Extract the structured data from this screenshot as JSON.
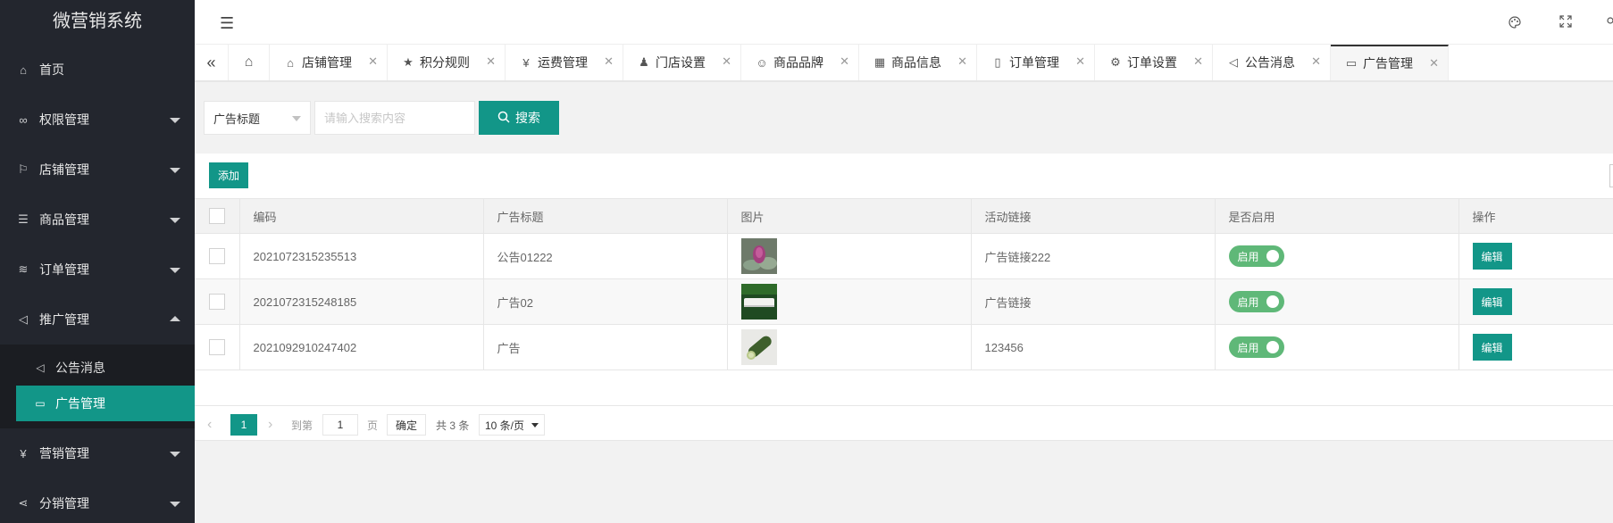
{
  "app": {
    "title": "微营销系统"
  },
  "sidebar": {
    "items": [
      {
        "label": "首页",
        "icon": "home-icon",
        "glyph": "⌂"
      },
      {
        "label": "权限管理",
        "icon": "link-icon",
        "glyph": "∞"
      },
      {
        "label": "店铺管理",
        "icon": "flag-icon",
        "glyph": "⚐"
      },
      {
        "label": "商品管理",
        "icon": "list-icon",
        "glyph": "☰"
      },
      {
        "label": "订单管理",
        "icon": "layers-icon",
        "glyph": "≋"
      },
      {
        "label": "推广管理",
        "icon": "speaker-icon",
        "glyph": "◁"
      },
      {
        "label": "营销管理",
        "icon": "yen-icon",
        "glyph": "¥"
      },
      {
        "label": "分销管理",
        "icon": "share-icon",
        "glyph": "⋖"
      }
    ],
    "submenu": [
      {
        "label": "公告消息",
        "icon": "speaker-icon",
        "glyph": "◁"
      },
      {
        "label": "广告管理",
        "icon": "book-icon",
        "glyph": "▭"
      }
    ]
  },
  "header": {
    "fold_glyph": "☰"
  },
  "tabs": [
    {
      "label": "店铺管理",
      "icon": "home-icon",
      "glyph": "⌂"
    },
    {
      "label": "积分规则",
      "icon": "star-icon",
      "glyph": "★"
    },
    {
      "label": "运费管理",
      "icon": "yen-icon",
      "glyph": "¥"
    },
    {
      "label": "门店设置",
      "icon": "users-icon",
      "glyph": "♟"
    },
    {
      "label": "商品品牌",
      "icon": "smile-icon",
      "glyph": "☺"
    },
    {
      "label": "商品信息",
      "icon": "calendar-icon",
      "glyph": "▦"
    },
    {
      "label": "订单管理",
      "icon": "clipboard-icon",
      "glyph": "▯"
    },
    {
      "label": "订单设置",
      "icon": "gear-icon",
      "glyph": "⚙"
    },
    {
      "label": "公告消息",
      "icon": "speaker-icon",
      "glyph": "◁"
    },
    {
      "label": "广告管理",
      "icon": "book-icon",
      "glyph": "▭"
    }
  ],
  "search": {
    "field_select": "广告标题",
    "placeholder": "请输入搜索内容",
    "button_label": "搜索"
  },
  "toolbar": {
    "add_label": "添加"
  },
  "table": {
    "columns": [
      "编码",
      "广告标题",
      "图片",
      "活动链接",
      "是否启用",
      "操作"
    ],
    "rows": [
      {
        "code": "2021072315235513",
        "title": "公告01222",
        "image": "purple-flower-thumbnail",
        "link": "广告链接222",
        "enabled": "启用",
        "action": "编辑"
      },
      {
        "code": "2021072315248185",
        "title": "广告02",
        "image": "air-conditioner-thumbnail",
        "link": "广告链接",
        "enabled": "启用",
        "action": "编辑"
      },
      {
        "code": "2021092910247402",
        "title": "广告",
        "image": "cucumber-thumbnail",
        "link": "123456",
        "enabled": "启用",
        "action": "编辑"
      }
    ]
  },
  "pager": {
    "current": "1",
    "goto_label": "到第",
    "goto_value": "1",
    "page_label": "页",
    "confirm_label": "确定",
    "total_label": "共 3 条",
    "page_size": "10 条/页"
  },
  "colors": {
    "accent": "#129688",
    "switch_on": "#5fb878",
    "sidebar_bg": "#23262e"
  }
}
